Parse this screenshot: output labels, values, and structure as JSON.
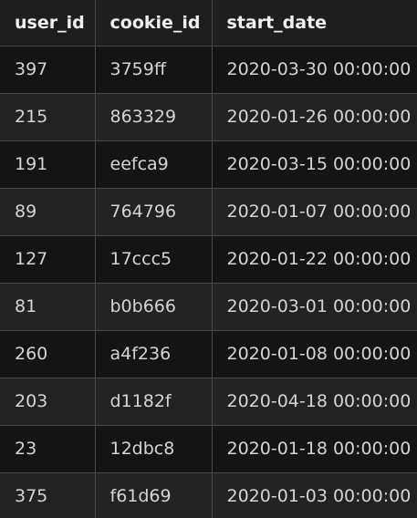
{
  "table": {
    "columns": [
      "user_id",
      "cookie_id",
      "start_date"
    ],
    "rows": [
      [
        "397",
        "3759ff",
        "2020-03-30 00:00:00"
      ],
      [
        "215",
        "863329",
        "2020-01-26 00:00:00"
      ],
      [
        "191",
        "eefca9",
        "2020-03-15 00:00:00"
      ],
      [
        "89",
        "764796",
        "2020-01-07 00:00:00"
      ],
      [
        "127",
        "17ccc5",
        "2020-01-22 00:00:00"
      ],
      [
        "81",
        "b0b666",
        "2020-03-01 00:00:00"
      ],
      [
        "260",
        "a4f236",
        "2020-01-08 00:00:00"
      ],
      [
        "203",
        "d1182f",
        "2020-04-18 00:00:00"
      ],
      [
        "23",
        "12dbc8",
        "2020-01-18 00:00:00"
      ],
      [
        "375",
        "f61d69",
        "2020-01-03 00:00:00"
      ]
    ]
  }
}
